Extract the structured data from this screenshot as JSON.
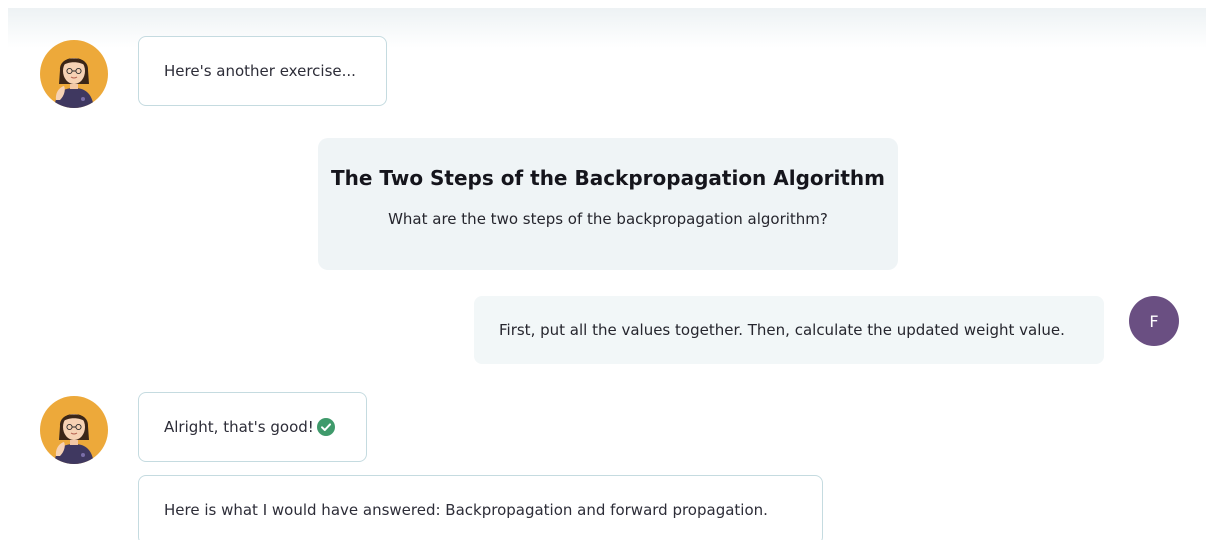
{
  "chat": {
    "messages": [
      {
        "role": "bot",
        "text": "Here's another exercise..."
      },
      {
        "role": "exercise",
        "title": "The Two Steps of the Backpropagation Algorithm",
        "question": "What are the two steps of the backpropagation algorithm?"
      },
      {
        "role": "user",
        "text": "First, put all the values together. Then, calculate the updated weight value.",
        "avatar_initial": "F"
      },
      {
        "role": "bot",
        "text": "Alright, that's good!",
        "icon": "check-circle-icon"
      },
      {
        "role": "bot",
        "text": "Here is what I would have answered: Backpropagation and forward propagation."
      }
    ]
  },
  "colors": {
    "bot_avatar_bg": "#eda93a",
    "user_avatar_bg": "#6a4f82",
    "check_green": "#3f9a6b",
    "bubble_border": "#c5dbe0",
    "card_bg": "#eff4f6"
  }
}
